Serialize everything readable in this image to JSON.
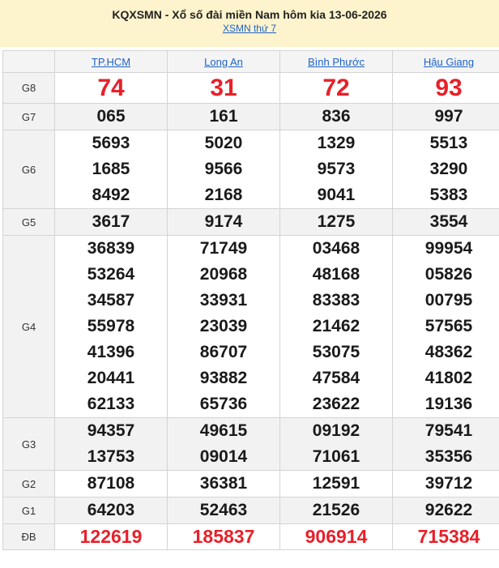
{
  "header": {
    "title": "KQXSMN - Xổ số đài miền Nam hôm kia 13-06-2026",
    "sub_link": "XSMN thứ 7"
  },
  "columns": [
    "TP.HCM",
    "Long An",
    "Bình Phước",
    "Hậu Giang"
  ],
  "prizes": [
    {
      "label": "G8",
      "values": [
        [
          "74"
        ],
        [
          "31"
        ],
        [
          "72"
        ],
        [
          "93"
        ]
      ]
    },
    {
      "label": "G7",
      "values": [
        [
          "065"
        ],
        [
          "161"
        ],
        [
          "836"
        ],
        [
          "997"
        ]
      ]
    },
    {
      "label": "G6",
      "values": [
        [
          "5693",
          "1685",
          "8492"
        ],
        [
          "5020",
          "9566",
          "2168"
        ],
        [
          "1329",
          "9573",
          "9041"
        ],
        [
          "5513",
          "3290",
          "5383"
        ]
      ]
    },
    {
      "label": "G5",
      "values": [
        [
          "3617"
        ],
        [
          "9174"
        ],
        [
          "1275"
        ],
        [
          "3554"
        ]
      ]
    },
    {
      "label": "G4",
      "values": [
        [
          "36839",
          "53264",
          "34587",
          "55978",
          "41396",
          "20441",
          "62133"
        ],
        [
          "71749",
          "20968",
          "33931",
          "23039",
          "86707",
          "93882",
          "65736"
        ],
        [
          "03468",
          "48168",
          "83383",
          "21462",
          "53075",
          "47584",
          "23622"
        ],
        [
          "99954",
          "05826",
          "00795",
          "57565",
          "48362",
          "41802",
          "19136"
        ]
      ]
    },
    {
      "label": "G3",
      "values": [
        [
          "94357",
          "13753"
        ],
        [
          "49615",
          "09014"
        ],
        [
          "09192",
          "71061"
        ],
        [
          "79541",
          "35356"
        ]
      ]
    },
    {
      "label": "G2",
      "values": [
        [
          "87108"
        ],
        [
          "36381"
        ],
        [
          "12591"
        ],
        [
          "39712"
        ]
      ]
    },
    {
      "label": "G1",
      "values": [
        [
          "64203"
        ],
        [
          "52463"
        ],
        [
          "21526"
        ],
        [
          "92622"
        ]
      ]
    },
    {
      "label": "ĐB",
      "values": [
        [
          "122619"
        ],
        [
          "185837"
        ],
        [
          "906914"
        ],
        [
          "715384"
        ]
      ]
    }
  ],
  "colors": {
    "header_bg": "#fdf3cc",
    "link": "#1d62c8",
    "highlight": "#e8202a",
    "alt_row": "#f2f2f2"
  }
}
